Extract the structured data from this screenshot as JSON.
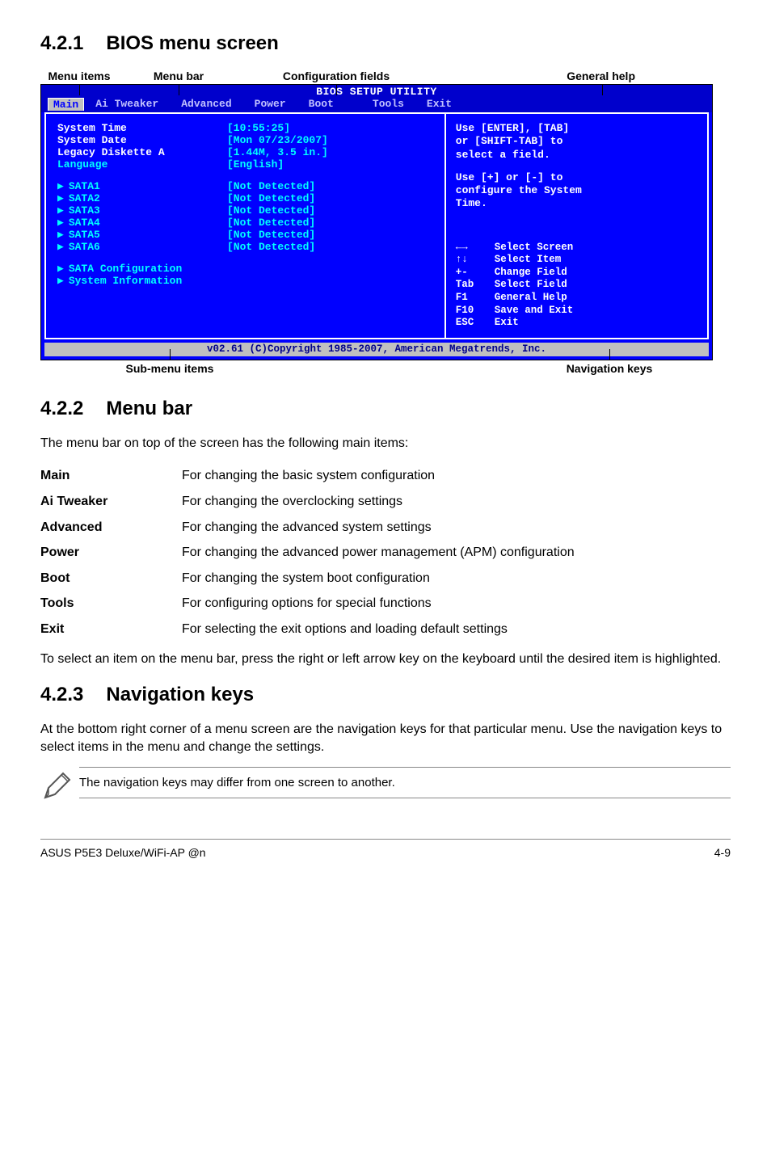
{
  "sections": {
    "s1": {
      "num": "4.2.1",
      "title": "BIOS menu screen"
    },
    "s2": {
      "num": "4.2.2",
      "title": "Menu bar"
    },
    "s3": {
      "num": "4.2.3",
      "title": "Navigation keys"
    }
  },
  "diagram_labels": {
    "menu_items": "Menu items",
    "menu_bar": "Menu bar",
    "config_fields": "Configuration fields",
    "general_help": "General help",
    "submenu": "Sub-menu items",
    "navkeys": "Navigation keys"
  },
  "bios": {
    "title": "BIOS SETUP UTILITY",
    "tabs": {
      "main": "Main",
      "ai": "Ai Tweaker",
      "adv": "Advanced",
      "power": "Power",
      "boot": "Boot",
      "tools": "Tools",
      "exit": "Exit"
    },
    "left": {
      "system_time": {
        "label": "System Time",
        "value": "[10:55:25]"
      },
      "system_date": {
        "label": "System Date",
        "value": "[Mon 07/23/2007]"
      },
      "legacy": {
        "label": "Legacy Diskette A",
        "value": "[1.44M, 3.5 in.]"
      },
      "language": {
        "label": "Language",
        "value": "[English]"
      },
      "sata1": {
        "label": "SATA1",
        "value": "[Not Detected]"
      },
      "sata2": {
        "label": "SATA2",
        "value": "[Not Detected]"
      },
      "sata3": {
        "label": "SATA3",
        "value": "[Not Detected]"
      },
      "sata4": {
        "label": "SATA4",
        "value": "[Not Detected]"
      },
      "sata5": {
        "label": "SATA5",
        "value": "[Not Detected]"
      },
      "sata6": {
        "label": "SATA6",
        "value": "[Not Detected]"
      },
      "sata_cfg": "SATA Configuration",
      "sys_info": "System Information"
    },
    "help_top_1": "Use [ENTER], [TAB]",
    "help_top_2": "or [SHIFT-TAB] to",
    "help_top_3": "select a field.",
    "help_top_4": "Use [+] or [-] to",
    "help_top_5": "configure the System",
    "help_top_6": "Time.",
    "keys": {
      "k1": {
        "k": "←→",
        "d": "Select Screen"
      },
      "k2": {
        "k": "↑↓",
        "d": "Select Item"
      },
      "k3": {
        "k": "+-",
        "d": "Change Field"
      },
      "k4": {
        "k": "Tab",
        "d": "Select Field"
      },
      "k5": {
        "k": "F1",
        "d": "General Help"
      },
      "k6": {
        "k": "F10",
        "d": "Save and Exit"
      },
      "k7": {
        "k": "ESC",
        "d": "Exit"
      }
    },
    "footer": "v02.61 (C)Copyright 1985-2007, American Megatrends, Inc."
  },
  "menubar_intro": "The menu bar on top of the screen has the following main items:",
  "defs": {
    "main": {
      "term": "Main",
      "desc": "For changing the basic system configuration"
    },
    "ai": {
      "term": "Ai Tweaker",
      "desc": "For changing the overclocking settings"
    },
    "adv": {
      "term": "Advanced",
      "desc": "For changing the advanced system settings"
    },
    "power": {
      "term": "Power",
      "desc": "For changing the advanced power management (APM) configuration"
    },
    "boot": {
      "term": "Boot",
      "desc": "For changing the system boot configuration"
    },
    "tools": {
      "term": "Tools",
      "desc": "For configuring options for special functions"
    },
    "exit": {
      "term": "Exit",
      "desc": "For selecting the exit options and loading default settings"
    }
  },
  "menubar_outro": "To select an item on the menu bar, press the right or left arrow key on the keyboard until the desired item is highlighted.",
  "navkeys_text": "At the bottom right corner of a menu screen are the navigation keys for that particular menu. Use the navigation keys to select items in the menu and change the settings.",
  "note_text": "The navigation keys may differ from one screen to another.",
  "footer": {
    "left": "ASUS P5E3 Deluxe/WiFi-AP @n",
    "right": "4-9"
  }
}
